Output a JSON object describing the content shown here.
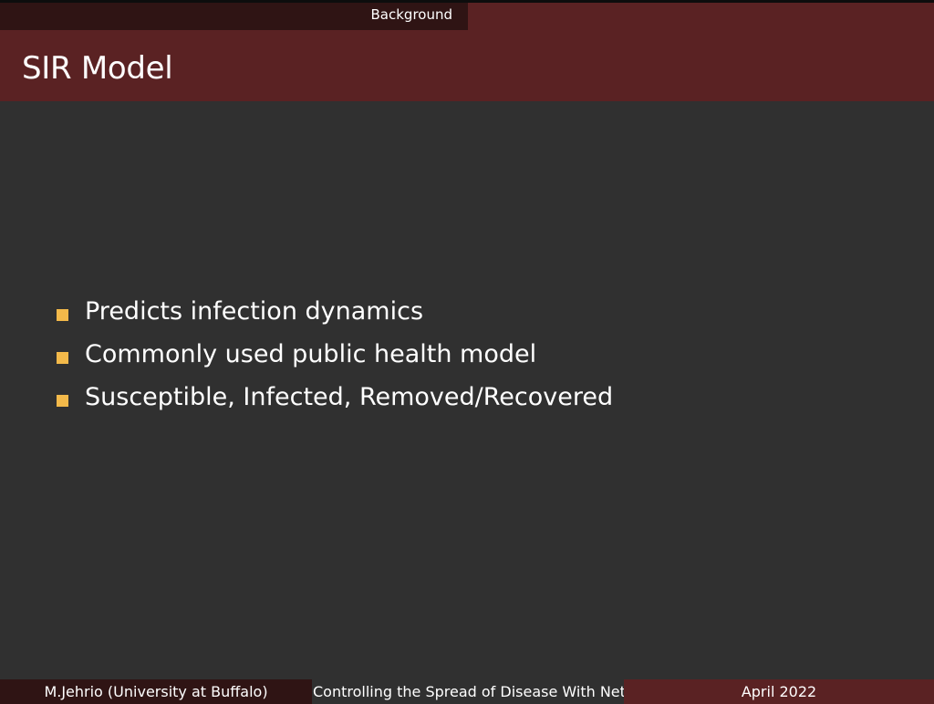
{
  "nav": {
    "section": "Background"
  },
  "slide": {
    "title": "SIR Model",
    "bullets": [
      "Predicts infection dynamics",
      "Commonly used public health model",
      "Susceptible, Infected, Removed/Recovered"
    ]
  },
  "footer": {
    "author": "M.Jehrio  (University at Buffalo)",
    "title": "Controlling the Spread of Disease With Netwo",
    "date": "April 2022"
  },
  "colors": {
    "header": "#5a2223",
    "header_dark": "#2f1414",
    "background": "#303030",
    "bullet": "#f3b94a"
  }
}
